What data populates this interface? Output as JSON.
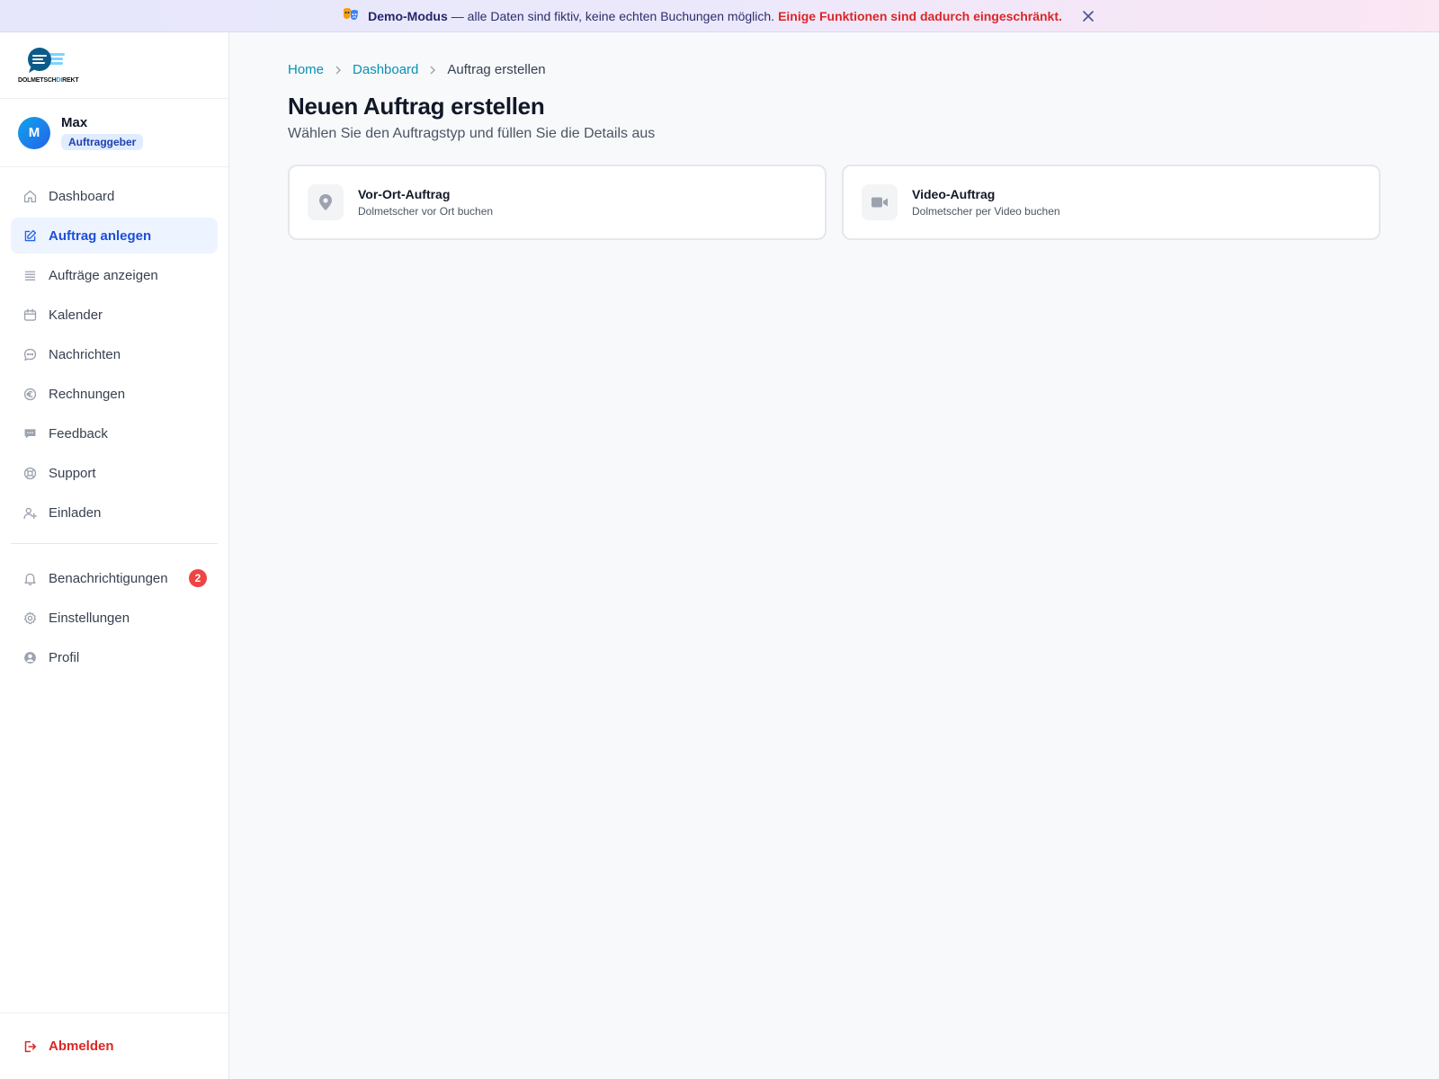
{
  "banner": {
    "icon": "theater-mask-icon",
    "title": "Demo-Modus",
    "text": "— alle Daten sind fiktiv, keine echten Buchungen möglich.",
    "warning": "Einige Funktionen sind dadurch eingeschränkt."
  },
  "brand": {
    "logo_text_a": "DOLMETSCH",
    "logo_text_b": "DI",
    "logo_text_c": "REKT"
  },
  "user": {
    "initial": "M",
    "name": "Max",
    "role": "Auftraggeber"
  },
  "nav": {
    "items": [
      {
        "label": "Dashboard",
        "icon": "home-icon"
      },
      {
        "label": "Auftrag anlegen",
        "icon": "edit-icon",
        "active": true
      },
      {
        "label": "Aufträge anzeigen",
        "icon": "list-icon"
      },
      {
        "label": "Kalender",
        "icon": "calendar-icon"
      },
      {
        "label": "Nachrichten",
        "icon": "chat-icon"
      },
      {
        "label": "Rechnungen",
        "icon": "euro-icon"
      },
      {
        "label": "Feedback",
        "icon": "feedback-icon"
      },
      {
        "label": "Support",
        "icon": "lifebuoy-icon"
      },
      {
        "label": "Einladen",
        "icon": "user-plus-icon"
      }
    ],
    "secondary": [
      {
        "label": "Benachrichtigungen",
        "icon": "bell-icon",
        "badge": "2"
      },
      {
        "label": "Einstellungen",
        "icon": "gear-icon"
      },
      {
        "label": "Profil",
        "icon": "user-circle-icon"
      }
    ],
    "logout": "Abmelden"
  },
  "breadcrumb": {
    "home": "Home",
    "dashboard": "Dashboard",
    "current": "Auftrag erstellen"
  },
  "page": {
    "title": "Neuen Auftrag erstellen",
    "subtitle": "Wählen Sie den Auftragstyp und füllen Sie die Details aus"
  },
  "cards": [
    {
      "title": "Vor-Ort-Auftrag",
      "desc": "Dolmetscher vor Ort buchen",
      "icon": "map-pin-icon"
    },
    {
      "title": "Video-Auftrag",
      "desc": "Dolmetscher per Video buchen",
      "icon": "video-camera-icon"
    }
  ],
  "colors": {
    "accent": "#1d4ed8",
    "link": "#0891b2",
    "danger": "#dc2626",
    "active_bg": "#eef4ff"
  }
}
